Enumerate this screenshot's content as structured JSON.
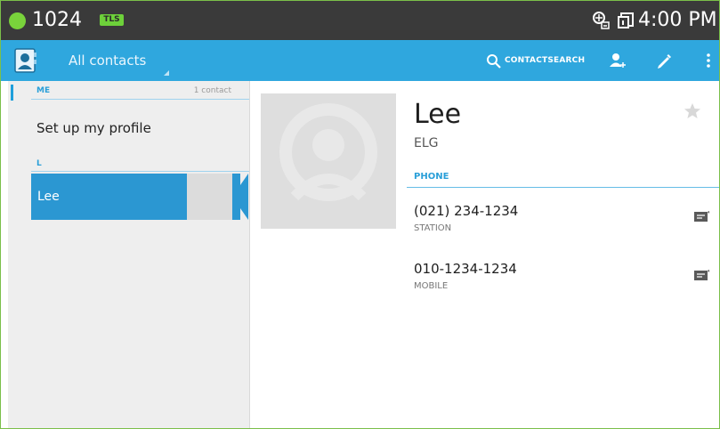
{
  "status_bar": {
    "number": "1024",
    "badge": "TLS",
    "time": "4:00 PM",
    "colors": {
      "background": "#3a3a3a",
      "dot": "#79d33b"
    }
  },
  "action_bar": {
    "title": "All contacts",
    "search_label": "CONTACTSEARCH",
    "icons": [
      "contacts-app-icon",
      "search-icon",
      "add-contact-icon",
      "edit-icon",
      "overflow-menu-icon"
    ],
    "colors": {
      "background": "#2fa7de"
    }
  },
  "contact_list": {
    "sections": [
      {
        "header": "ME",
        "count": "1 contact",
        "items": [
          "Set up my profile"
        ]
      },
      {
        "header": "L",
        "items": [
          "Lee"
        ]
      }
    ],
    "selected": "Lee",
    "colors": {
      "selected": "#2b97d2",
      "section_header": "#2a9fd8"
    }
  },
  "detail": {
    "name": "Lee",
    "company": "ELG",
    "phone_header": "PHONE",
    "phones": [
      {
        "number": "(021) 234-1234",
        "type": "STATION"
      },
      {
        "number": "010-1234-1234",
        "type": "MOBILE"
      }
    ]
  }
}
